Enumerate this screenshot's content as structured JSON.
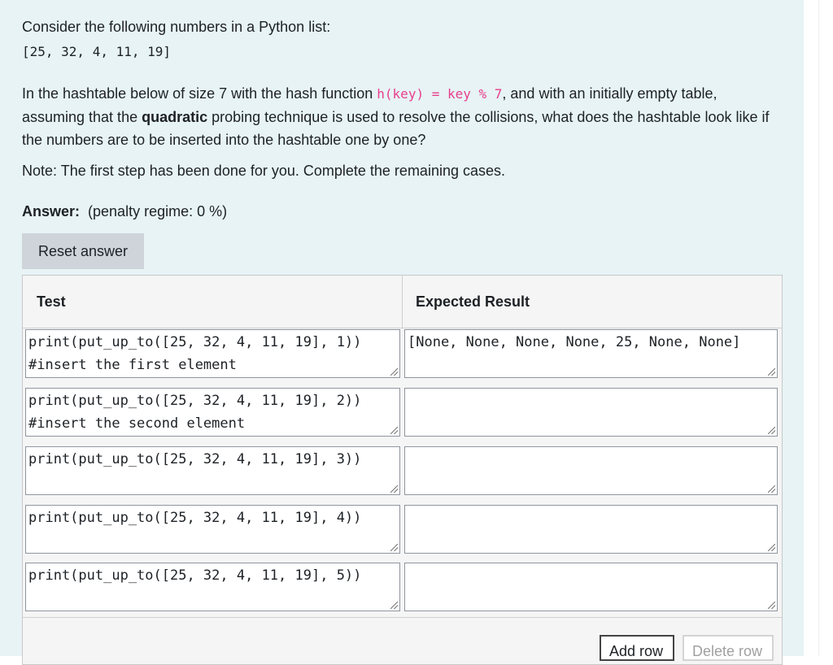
{
  "question": {
    "intro": "Consider the following numbers in a Python list:",
    "list": "[25, 32, 4, 11, 19]",
    "para_before_code": "In the hashtable below of size 7 with the hash function ",
    "hash_code": "h(key) = key % 7",
    "para_mid_1": ", and with an initially empty table, assuming that the ",
    "para_bold": "quadratic",
    "para_after": " probing technique is used to resolve the collisions, what does the hashtable look like if the numbers are to be inserted into the hashtable one by one?",
    "note": "Note: The first step has been done for you. Complete the remaining cases."
  },
  "answer": {
    "label": "Answer:",
    "penalty": "(penalty regime: 0 %)"
  },
  "reset_button": "Reset answer",
  "table": {
    "header_test": "Test",
    "header_expected": "Expected Result",
    "rows": [
      {
        "test": "print(put_up_to([25, 32, 4, 11, 19], 1)) #insert the first element",
        "expected": "[None, None, None, None, 25, None, None]"
      },
      {
        "test": "print(put_up_to([25, 32, 4, 11, 19], 2)) #insert the second element",
        "expected": ""
      },
      {
        "test": "print(put_up_to([25, 32, 4, 11, 19], 3))",
        "expected": ""
      },
      {
        "test": "print(put_up_to([25, 32, 4, 11, 19], 4))",
        "expected": ""
      },
      {
        "test": "print(put_up_to([25, 32, 4, 11, 19], 5))",
        "expected": ""
      }
    ]
  },
  "buttons": {
    "add_row": "Add row",
    "delete_row": "Delete row"
  }
}
